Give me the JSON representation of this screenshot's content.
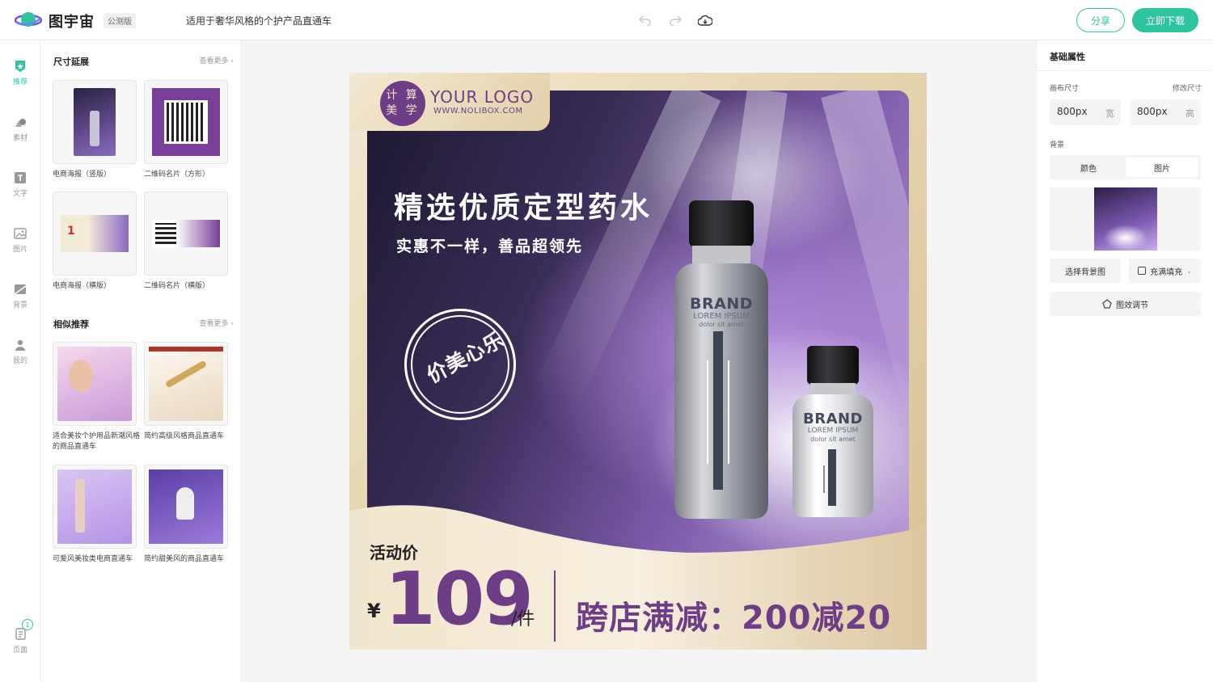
{
  "header": {
    "app_name": "图宇宙",
    "edition_badge": "公测版",
    "doc_title": "适用于奢华风格的个护产品直通车",
    "share_label": "分享",
    "download_label": "立即下载"
  },
  "rail": {
    "items": [
      {
        "label": "推荐"
      },
      {
        "label": "素材"
      },
      {
        "label": "文字"
      },
      {
        "label": "图片"
      },
      {
        "label": "背景"
      },
      {
        "label": "我的"
      }
    ],
    "pages_label": "页面",
    "page_count": "1"
  },
  "panel": {
    "size_section": {
      "title": "尺寸延展",
      "more": "查看更多",
      "items": [
        {
          "caption": "电商海报（竖版）"
        },
        {
          "caption": "二维码名片（方形）"
        },
        {
          "caption": "电商海报（横版）"
        },
        {
          "caption": "二维码名片（横版）"
        }
      ]
    },
    "similar_section": {
      "title": "相似推荐",
      "more": "查看更多",
      "items": [
        {
          "caption": "适合美妆个护用品新潮风格的商品直通车"
        },
        {
          "caption": "简约高级风格商品直通车"
        },
        {
          "caption": "可爱风美妆类电商直通车"
        },
        {
          "caption": "简约甜美风的商品直通车"
        }
      ]
    }
  },
  "props": {
    "title": "基础属性",
    "canvas_size_label": "画布尺寸",
    "modify_size_label": "修改尺寸",
    "width_value": "800px",
    "width_unit": "宽",
    "height_value": "800px",
    "height_unit": "高",
    "background_label": "背景",
    "bg_tabs": [
      "颜色",
      "图片"
    ],
    "choose_bg_label": "选择背景图",
    "fill_mode_label": "充满填充",
    "adjust_label": "图效调节"
  },
  "poster": {
    "logo_circle_line1": "计 算",
    "logo_circle_line2": "美 学",
    "logo_main": "YOUR LOGO",
    "logo_url": "WWW.NOLIBOX.COM",
    "headline": "精选优质定型药水",
    "subline": "实惠不一样，善品超领先",
    "stamp": "价美心乐",
    "bottle_brand": "BRAND",
    "bottle_lorem": "LOREM IPSUM",
    "bottle_dolor": "dolor sit amet",
    "price_label": "活动价",
    "currency": "¥",
    "price": "109",
    "unit": "/件",
    "promo": "跨店满减：200减20"
  },
  "colors": {
    "accent": "#2ec4a0",
    "poster_purple": "#6d3d86",
    "poster_gold": "#e4d2ac"
  }
}
